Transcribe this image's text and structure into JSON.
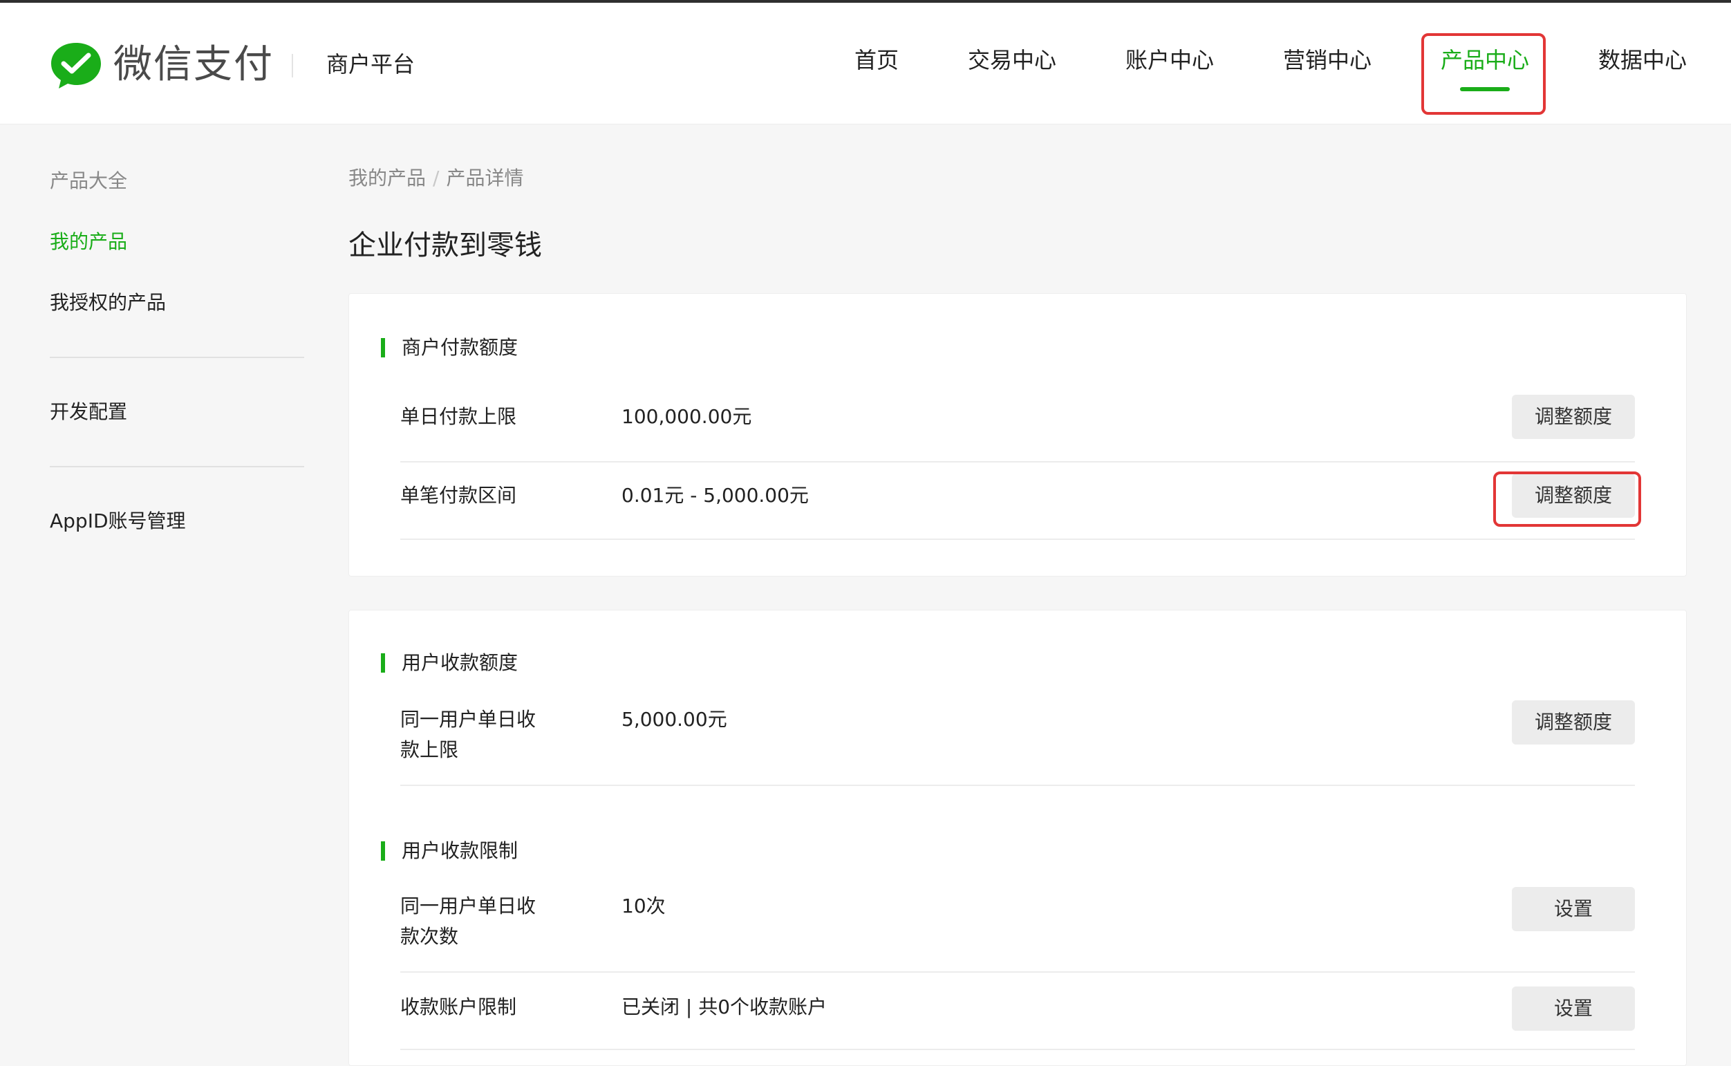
{
  "header": {
    "brand": "微信支付",
    "platform": "商户平台",
    "nav": [
      {
        "label": "首页"
      },
      {
        "label": "交易中心"
      },
      {
        "label": "账户中心"
      },
      {
        "label": "营销中心"
      },
      {
        "label": "产品中心",
        "active": true
      },
      {
        "label": "数据中心"
      }
    ]
  },
  "colors": {
    "accent": "#1aad19",
    "highlight": "#e23636",
    "button_bg": "#ececec"
  },
  "sidebar": {
    "items": [
      {
        "label": "产品大全"
      },
      {
        "label": "我的产品",
        "active": true
      },
      {
        "label": "我授权的产品"
      },
      {
        "label": "开发配置"
      },
      {
        "label": "AppID账号管理"
      }
    ]
  },
  "breadcrumb": {
    "parent": "我的产品",
    "separator": "/",
    "current": "产品详情"
  },
  "page": {
    "title": "企业付款到零钱"
  },
  "merchant_quota": {
    "title": "商户付款额度",
    "rows": [
      {
        "label": "单日付款上限",
        "value": "100,000.00元",
        "button": "调整额度"
      },
      {
        "label": "单笔付款区间",
        "value": "0.01元 - 5,000.00元",
        "button": "调整额度"
      }
    ]
  },
  "user_quota": {
    "title": "用户收款额度",
    "rows": [
      {
        "label": "同一用户单日收款上限",
        "value": "5,000.00元",
        "button": "调整额度"
      }
    ]
  },
  "user_limit": {
    "title": "用户收款限制",
    "rows": [
      {
        "label": "同一用户单日收款次数",
        "value": "10次",
        "button": "设置"
      },
      {
        "label": "收款账户限制",
        "value": "已关闭 | 共0个收款账户",
        "button": "设置"
      }
    ]
  }
}
